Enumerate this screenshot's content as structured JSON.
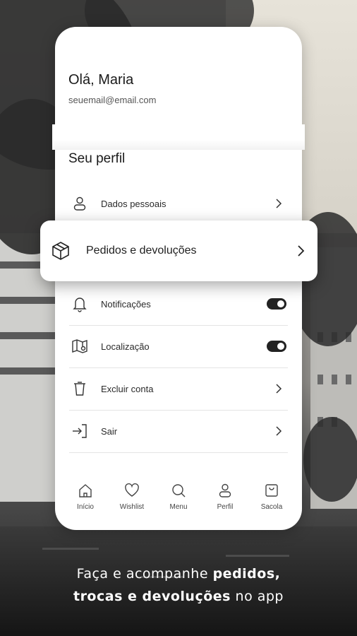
{
  "profile": {
    "greeting": "Olá, Maria",
    "email": "seuemail@email.com",
    "section_title": "Seu perfil"
  },
  "menu": {
    "dados": "Dados pessoais",
    "pedidos": "Pedidos e devoluções",
    "notificacoes": "Notificações",
    "localizacao": "Localização",
    "excluir": "Excluir conta",
    "sair": "Sair"
  },
  "toggles": {
    "notificacoes_on": true,
    "localizacao_on": true
  },
  "nav": {
    "inicio": "Início",
    "wishlist": "Wishlist",
    "menu": "Menu",
    "perfil": "Perfil",
    "sacola": "Sacola"
  },
  "caption": {
    "line1_a": "Faça e acompanhe ",
    "line1_b": "pedidos,",
    "line2_a": "trocas e devoluções",
    "line2_b": " no app"
  },
  "icons": {
    "dados": "user-icon",
    "pedidos": "box-icon",
    "notificacoes": "bell-icon",
    "localizacao": "map-icon",
    "excluir": "trash-icon",
    "sair": "logout-icon"
  },
  "colors": {
    "accent": "#222222",
    "card": "#ffffff",
    "caption": "#ffffff"
  }
}
